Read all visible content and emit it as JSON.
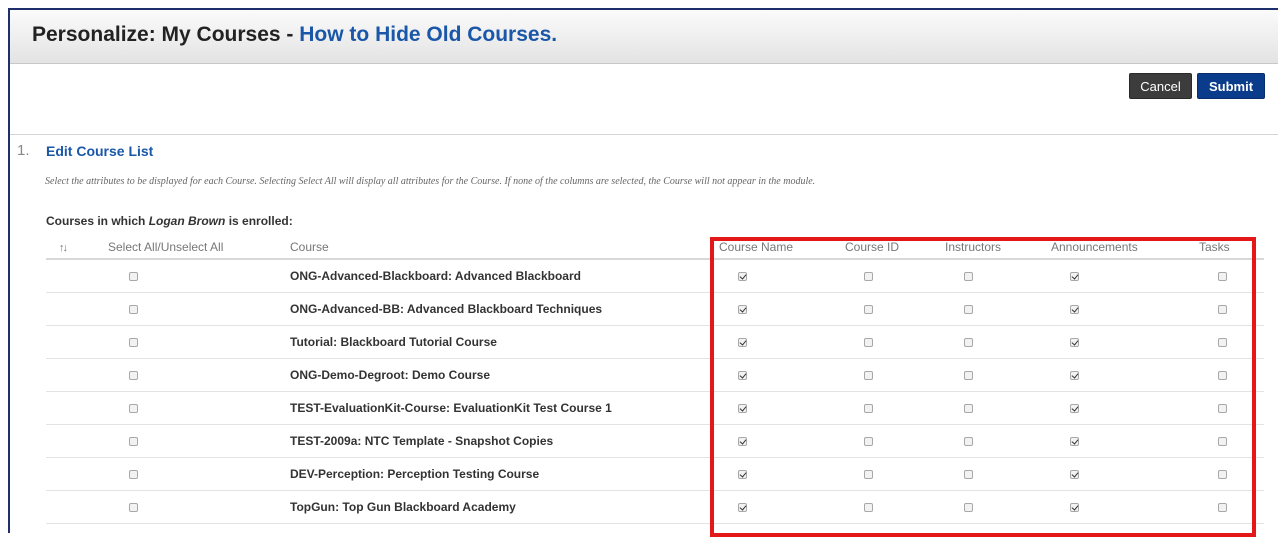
{
  "header": {
    "prefix": "Personalize: My Courses - ",
    "link": "How to Hide Old Courses."
  },
  "actions": {
    "cancel": "Cancel",
    "submit": "Submit"
  },
  "section": {
    "number": "1.",
    "title": "Edit Course List",
    "instructions": "Select the attributes to be displayed for each Course. Selecting Select All will display all attributes for the Course. If none of the columns are selected, the Course will not appear in the module.",
    "enrolled_prefix": "Courses in which ",
    "enrolled_user": "Logan Brown",
    "enrolled_suffix": " is enrolled:"
  },
  "table": {
    "sort_icon": "↑↓",
    "headers": {
      "select_all": "Select All/Unselect All",
      "course": "Course",
      "course_name": "Course Name",
      "course_id": "Course ID",
      "instructors": "Instructors",
      "announcements": "Announcements",
      "tasks": "Tasks"
    },
    "rows": [
      {
        "course": "ONG-Advanced-Blackboard: Advanced Blackboard",
        "select_all": false,
        "course_name": true,
        "course_id": false,
        "instructors": false,
        "announcements": true,
        "tasks": false
      },
      {
        "course": "ONG-Advanced-BB: Advanced Blackboard Techniques",
        "select_all": false,
        "course_name": true,
        "course_id": false,
        "instructors": false,
        "announcements": true,
        "tasks": false
      },
      {
        "course": "Tutorial: Blackboard Tutorial Course",
        "select_all": false,
        "course_name": true,
        "course_id": false,
        "instructors": false,
        "announcements": true,
        "tasks": false
      },
      {
        "course": "ONG-Demo-Degroot: Demo Course",
        "select_all": false,
        "course_name": true,
        "course_id": false,
        "instructors": false,
        "announcements": true,
        "tasks": false
      },
      {
        "course": "TEST-EvaluationKit-Course: EvaluationKit Test Course 1",
        "select_all": false,
        "course_name": true,
        "course_id": false,
        "instructors": false,
        "announcements": true,
        "tasks": false
      },
      {
        "course": "TEST-2009a: NTC Template - Snapshot Copies",
        "select_all": false,
        "course_name": true,
        "course_id": false,
        "instructors": false,
        "announcements": true,
        "tasks": false
      },
      {
        "course": "DEV-Perception: Perception Testing Course",
        "select_all": false,
        "course_name": true,
        "course_id": false,
        "instructors": false,
        "announcements": true,
        "tasks": false
      },
      {
        "course": "TopGun: Top Gun Blackboard Academy",
        "select_all": false,
        "course_name": true,
        "course_id": false,
        "instructors": false,
        "announcements": true,
        "tasks": false
      }
    ]
  },
  "colors": {
    "highlight": "#e41818",
    "link": "#1a57a8",
    "submit": "#0b3c8c"
  }
}
